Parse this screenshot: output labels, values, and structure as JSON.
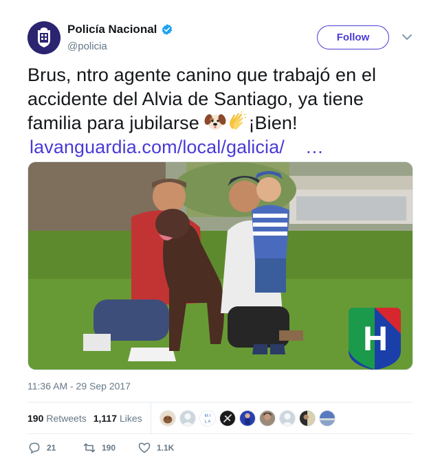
{
  "author": {
    "display_name": "Policía Nacional",
    "handle": "@policia",
    "verified": true,
    "verified_color": "#1da1f2",
    "avatar_bg": "#2b2470"
  },
  "follow": {
    "label": "Follow",
    "color": "#4a3ad6"
  },
  "tweet": {
    "text_line1": "Brus, ntro agente canino que trabajó en el",
    "text_line2": "accidente del Alvia de Santiago, ya tiene",
    "text_line3_a": "familia para jubilarse",
    "text_line3_b": "¡Bien!",
    "emojis": [
      "dog-face",
      "clapping-hands"
    ],
    "link": "lavanguardia.com/local/galicia/",
    "link_ellipsis": "…",
    "link_color": "#4a3ad6"
  },
  "media": {
    "logo_letter": "H"
  },
  "timestamp": "11:36 AM - 29 Sep 2017",
  "stats": {
    "retweets_count": "190",
    "retweets_label": "Retweets",
    "likes_count": "1,117",
    "likes_label": "Likes",
    "liker_avatars": [
      "dog-portrait",
      "default-profile",
      "mila-logo",
      "dark-emblem",
      "blue-figure",
      "woman-portrait",
      "default-profile",
      "dark-portrait",
      "landscape"
    ],
    "liker_initials": [
      "M I",
      "L A"
    ]
  },
  "actions": {
    "replies": "21",
    "retweets": "190",
    "likes": "1.1K"
  }
}
